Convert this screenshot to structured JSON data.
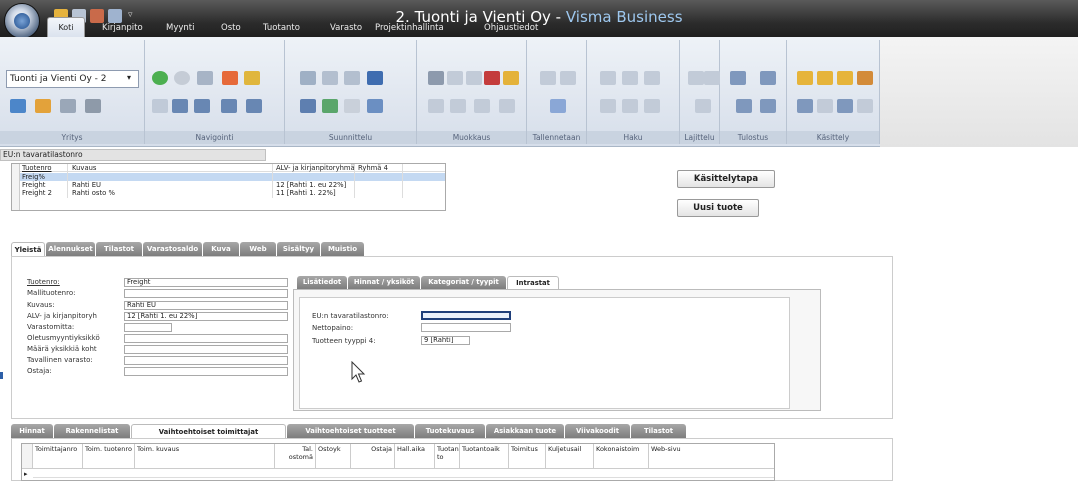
{
  "window": {
    "title_main": "2. Tuonti ja Vienti Oy - ",
    "title_app": "Visma Business"
  },
  "menu_tabs": [
    "Koti",
    "Kirjanpito",
    "Myynti",
    "Osto",
    "Tuotanto",
    "Varasto",
    "Projektinhallinta",
    "Ohjaustiedot"
  ],
  "ribbon": {
    "company": "Tuonti ja Vienti Oy - 2",
    "groups": [
      "Yritys",
      "Navigointi",
      "Suunnittelu",
      "Muokkaus",
      "Tallennetaan",
      "Haku",
      "Lajittelu",
      "Tulostus",
      "Käsittely"
    ]
  },
  "section_header": "EU:n tavaratilastonro",
  "top_grid": {
    "headers": [
      "Tuotenro",
      "Kuvaus",
      "ALV- ja kirjanpitoryhmä",
      "Ryhmä 4"
    ],
    "rows": [
      {
        "tuotenro": "Freig%",
        "kuvaus": "",
        "alv": ""
      },
      {
        "tuotenro": "Freight",
        "kuvaus": "Rahti EU",
        "alv": "12 [Rahti 1. eu 22%]"
      },
      {
        "tuotenro": "Freight 2",
        "kuvaus": "Rahti osto %",
        "alv": "11 [Rahti 1. 22%]"
      }
    ]
  },
  "buttons": {
    "kasittelytapa": "Käsittelytapa",
    "uusi_tuote": "Uusi tuote"
  },
  "main_tabs": [
    "Yleistä",
    "Alennukset",
    "Tilastot",
    "Varastosaldo",
    "Kuva",
    "Web",
    "Sisältyy",
    "Muistio"
  ],
  "form": {
    "labels": [
      "Tuotenro:",
      "Mallituotenro:",
      "Kuvaus:",
      "ALV- ja kirjanpitoryh",
      "Varastomitta:",
      "Oletusmyyntiyksikkö",
      "Määrä yksikkiä koht",
      "Tavallinen varasto:",
      "Ostaja:"
    ],
    "values": [
      "Freight",
      "",
      "Rahti EU",
      "12 [Rahti 1. eu 22%]",
      "",
      "",
      "",
      "",
      ""
    ]
  },
  "sub_tabs": [
    "Lisätiedot",
    "Hinnat / yksiköt",
    "Kategoriat / tyypit",
    "Intrastat"
  ],
  "intrastat": {
    "labels": [
      "EU:n tavaratilastonro:",
      "Nettopaino:",
      "Tuotteen tyyppi 4:"
    ],
    "values": [
      "",
      "",
      "9 [Rahti]"
    ]
  },
  "bottom_tabs": [
    "Hinnat",
    "Rakennelistat",
    "Vaihtoehtoiset toimittajat",
    "Vaihtoehtoiset tuotteet",
    "Tuotekuvaus",
    "Asiakkaan tuote",
    "Viivakoodit",
    "Tilastot"
  ],
  "bottom_grid_headers": [
    "Toimittajanro",
    "Toim. tuotenro",
    "Toim. kuvaus",
    "Tal. ostomä",
    "Ostoyk",
    "Ostaja",
    "Hall.aika",
    "Tuotan-to",
    "Tuotantoaik",
    "Toimitus",
    "Kuljetusail",
    "Kokonaistoim",
    "Web-sivu"
  ]
}
